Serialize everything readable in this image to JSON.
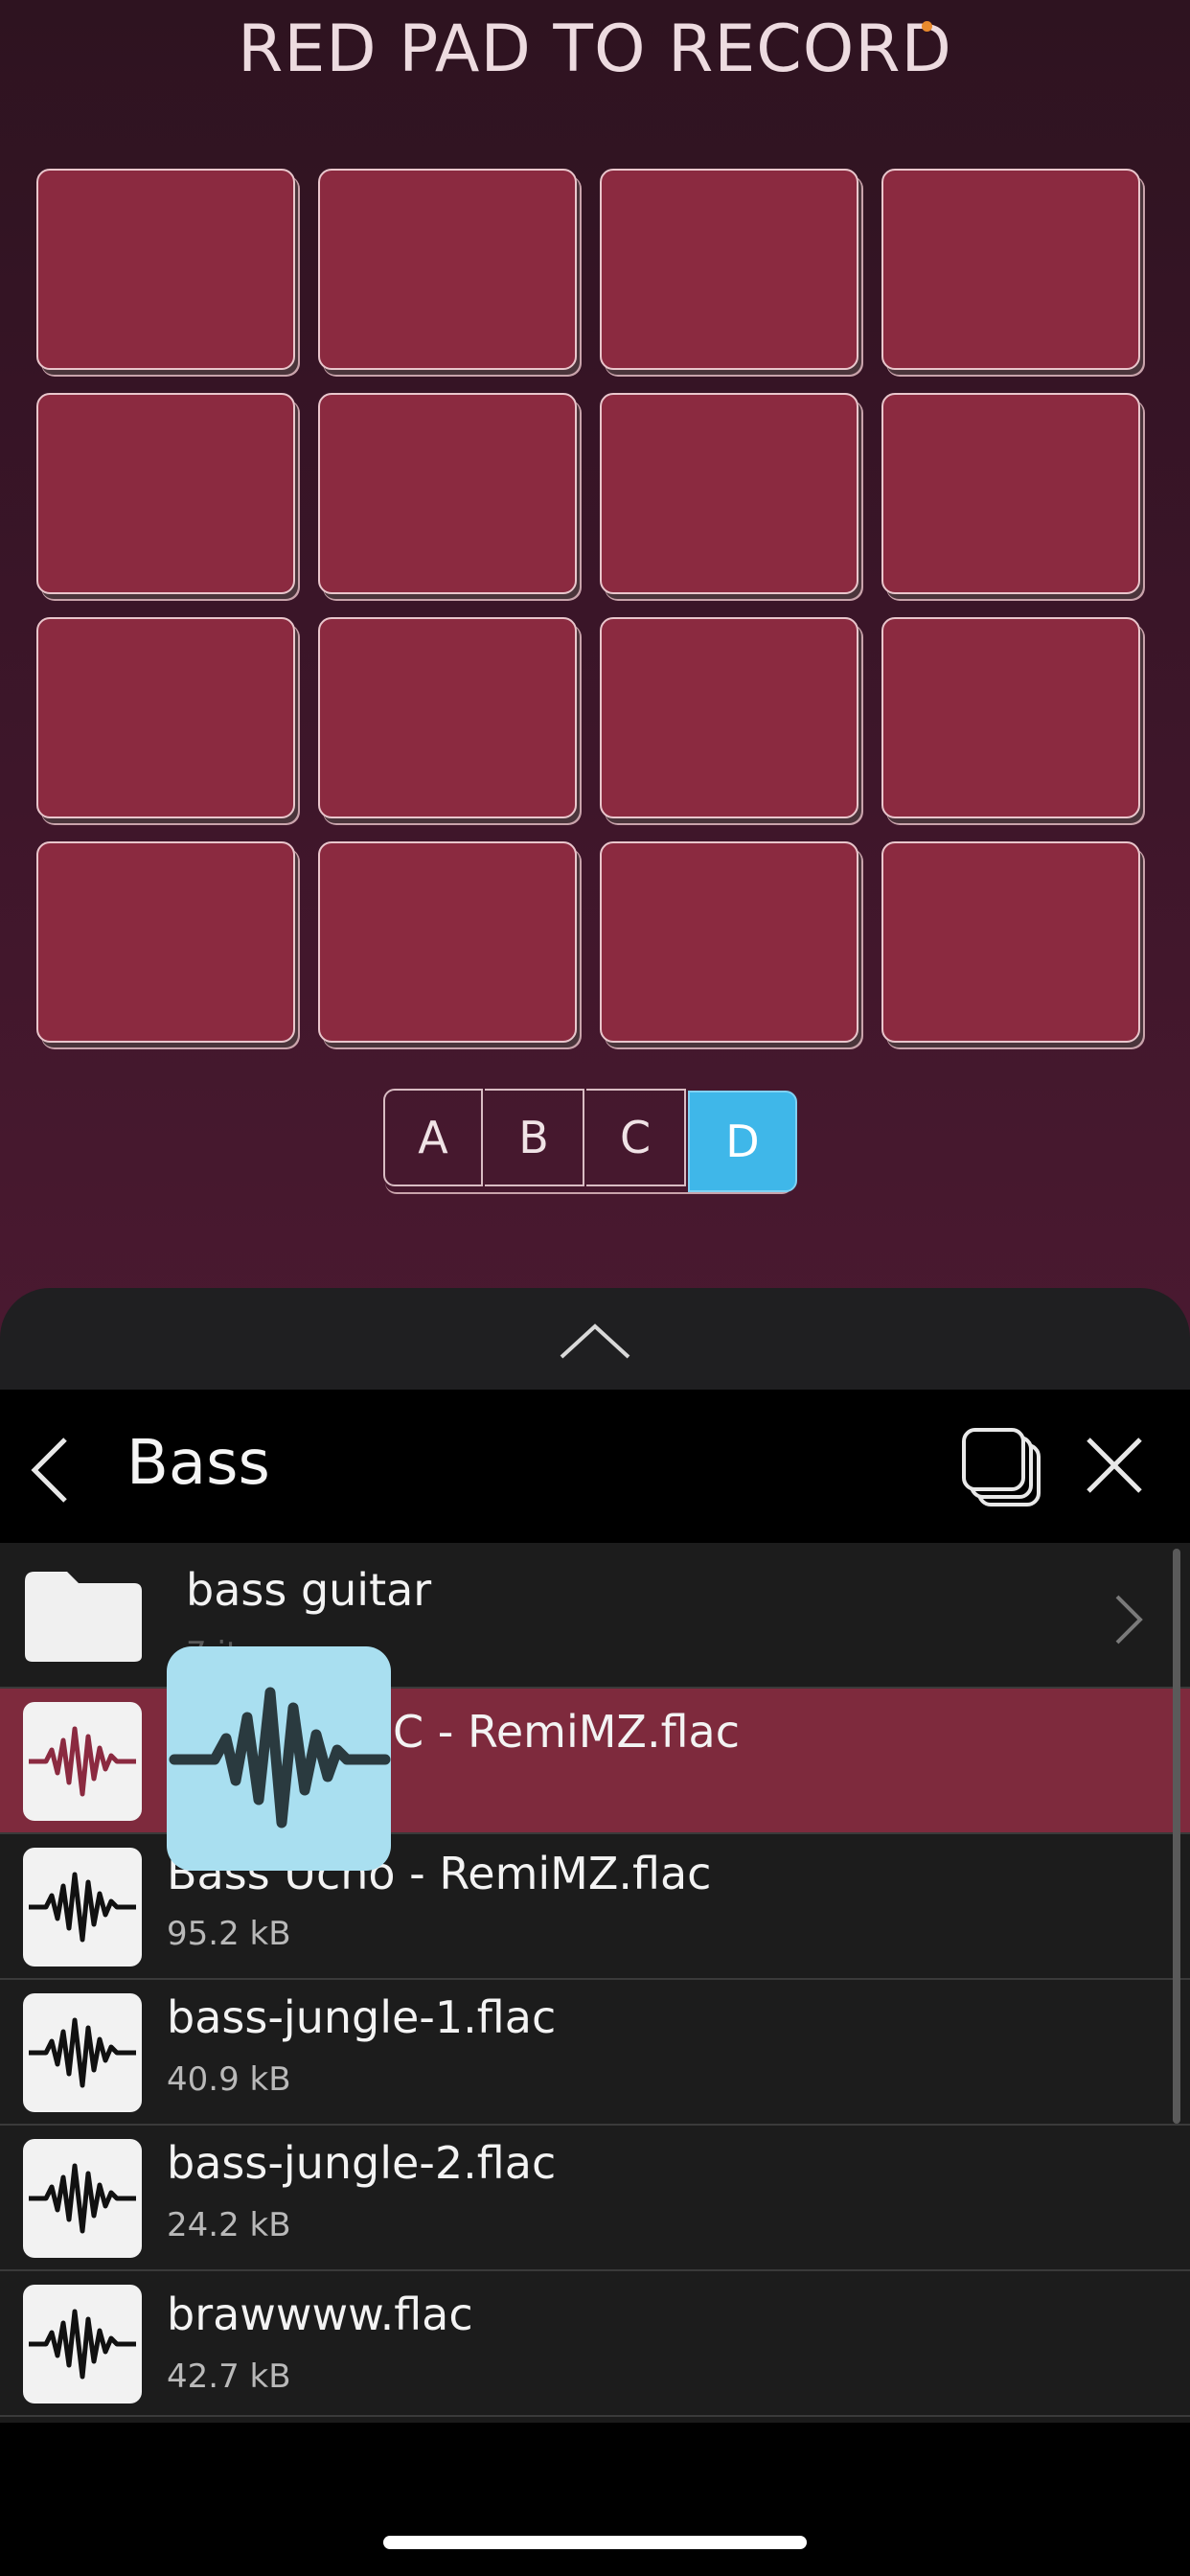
{
  "recorder": {
    "title": "RED PAD TO RECORD",
    "pad_color": "#8b2a40",
    "pads": [
      {
        "state": "empty"
      },
      {
        "state": "empty"
      },
      {
        "state": "empty"
      },
      {
        "state": "empty"
      },
      {
        "state": "empty"
      },
      {
        "state": "empty"
      },
      {
        "state": "empty"
      },
      {
        "state": "empty"
      },
      {
        "state": "empty"
      },
      {
        "state": "empty"
      },
      {
        "state": "empty"
      },
      {
        "state": "empty"
      },
      {
        "state": "empty"
      },
      {
        "state": "empty"
      },
      {
        "state": "empty"
      },
      {
        "state": "empty"
      }
    ],
    "banks": [
      {
        "label": "A",
        "active": false
      },
      {
        "label": "B",
        "active": false
      },
      {
        "label": "C",
        "active": false
      },
      {
        "label": "D",
        "active": true
      }
    ],
    "active_bank_color": "#3fb7e9"
  },
  "drawer": {
    "handle_icon": "chevron-up-icon"
  },
  "browser": {
    "title": "Bass",
    "back_icon": "chevron-left-icon",
    "layers_icon": "stacked-layers-icon",
    "close_icon": "close-icon",
    "items": [
      {
        "type": "folder",
        "name": "bass guitar",
        "meta": "7 items",
        "icon": "folder-icon"
      },
      {
        "type": "file",
        "name": "Bass C - RemiMZ.flac",
        "name_visible": "C - RemiMZ.flac",
        "meta": "",
        "icon": "waveform-icon",
        "selected": true
      },
      {
        "type": "file",
        "name": "Bass Ucho - RemiMZ.flac",
        "meta": "95.2 kB",
        "icon": "waveform-icon"
      },
      {
        "type": "file",
        "name": "bass-jungle-1.flac",
        "meta": "40.9 kB",
        "icon": "waveform-icon"
      },
      {
        "type": "file",
        "name": "bass-jungle-2.flac",
        "meta": "24.2 kB",
        "icon": "waveform-icon"
      },
      {
        "type": "file",
        "name": "brawwww.flac",
        "meta": "42.7 kB",
        "icon": "waveform-icon"
      }
    ],
    "highlight_color": "#7e2a3d"
  },
  "drag_ghost": {
    "icon": "waveform-icon",
    "color": "#a9dff0"
  }
}
